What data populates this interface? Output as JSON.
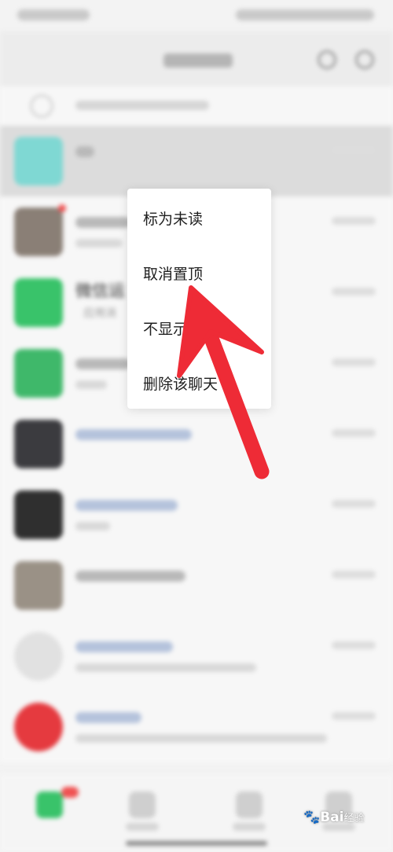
{
  "context_menu": {
    "items": [
      {
        "label": "标为未读"
      },
      {
        "label": "取消置顶"
      },
      {
        "label": "不显示该聊天"
      },
      {
        "label": "删除该聊天"
      }
    ]
  },
  "chat_list": {
    "visible_partial_texts": {
      "row3_title": "微信运",
      "row3_subtitle": "应用消",
      "row2_title": "科技小",
      "row2_subtitle": "文"
    }
  },
  "colors": {
    "annotation_arrow": "#ee2b36",
    "wechat_green": "#39c36a",
    "menu_background": "#ffffff"
  },
  "watermark": {
    "brand": "Bai",
    "suffix": "经验",
    "icon": "baidu-paw-icon"
  }
}
